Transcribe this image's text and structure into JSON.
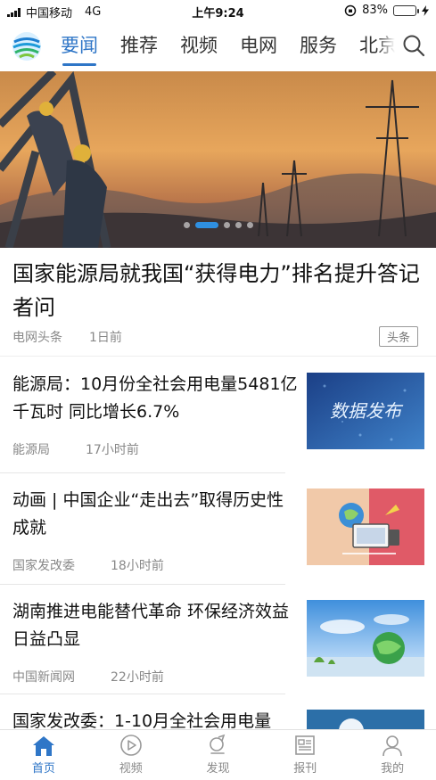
{
  "status_bar": {
    "carrier": "中国移动",
    "network": "4G",
    "time": "上午9:24",
    "battery_text": "83%",
    "battery_level": 0.83
  },
  "nav": {
    "tabs": [
      {
        "label": "要闻",
        "active": true
      },
      {
        "label": "推荐",
        "active": false
      },
      {
        "label": "视频",
        "active": false
      },
      {
        "label": "电网",
        "active": false
      },
      {
        "label": "服务",
        "active": false
      },
      {
        "label": "北京",
        "active": false
      }
    ],
    "search_icon": "search-icon"
  },
  "banner": {
    "slide_count": 5,
    "active_slide": 1
  },
  "headline": {
    "title": "国家能源局就我国“获得电力”排名提升答记者问",
    "source": "电网头条",
    "time": "1日前",
    "tag": "头条"
  },
  "news": [
    {
      "title": "能源局：10月份全社会用电量5481亿千瓦时 同比增长6.7%",
      "source": "能源局",
      "time": "17小时前",
      "thumb_text": "数据发布"
    },
    {
      "title": "动画 | 中国企业“走出去”取得历史性成就",
      "source": "国家发改委",
      "time": "18小时前",
      "thumb_text": ""
    },
    {
      "title": "湖南推进电能替代革命 环保经济效益日益凸显",
      "source": "中国新闻网",
      "time": "22小时前",
      "thumb_text": ""
    },
    {
      "title": "国家发改委：1-10月全社会用电量",
      "source": "",
      "time": "",
      "thumb_text": ""
    }
  ],
  "tabbar": [
    {
      "label": "首页",
      "icon": "home-icon",
      "active": true
    },
    {
      "label": "视频",
      "icon": "play-icon",
      "active": false
    },
    {
      "label": "发现",
      "icon": "discover-icon",
      "active": false
    },
    {
      "label": "报刊",
      "icon": "newspaper-icon",
      "active": false
    },
    {
      "label": "我的",
      "icon": "profile-icon",
      "active": false
    }
  ],
  "colors": {
    "accent": "#2f76c7",
    "battery": "#33c24a"
  }
}
